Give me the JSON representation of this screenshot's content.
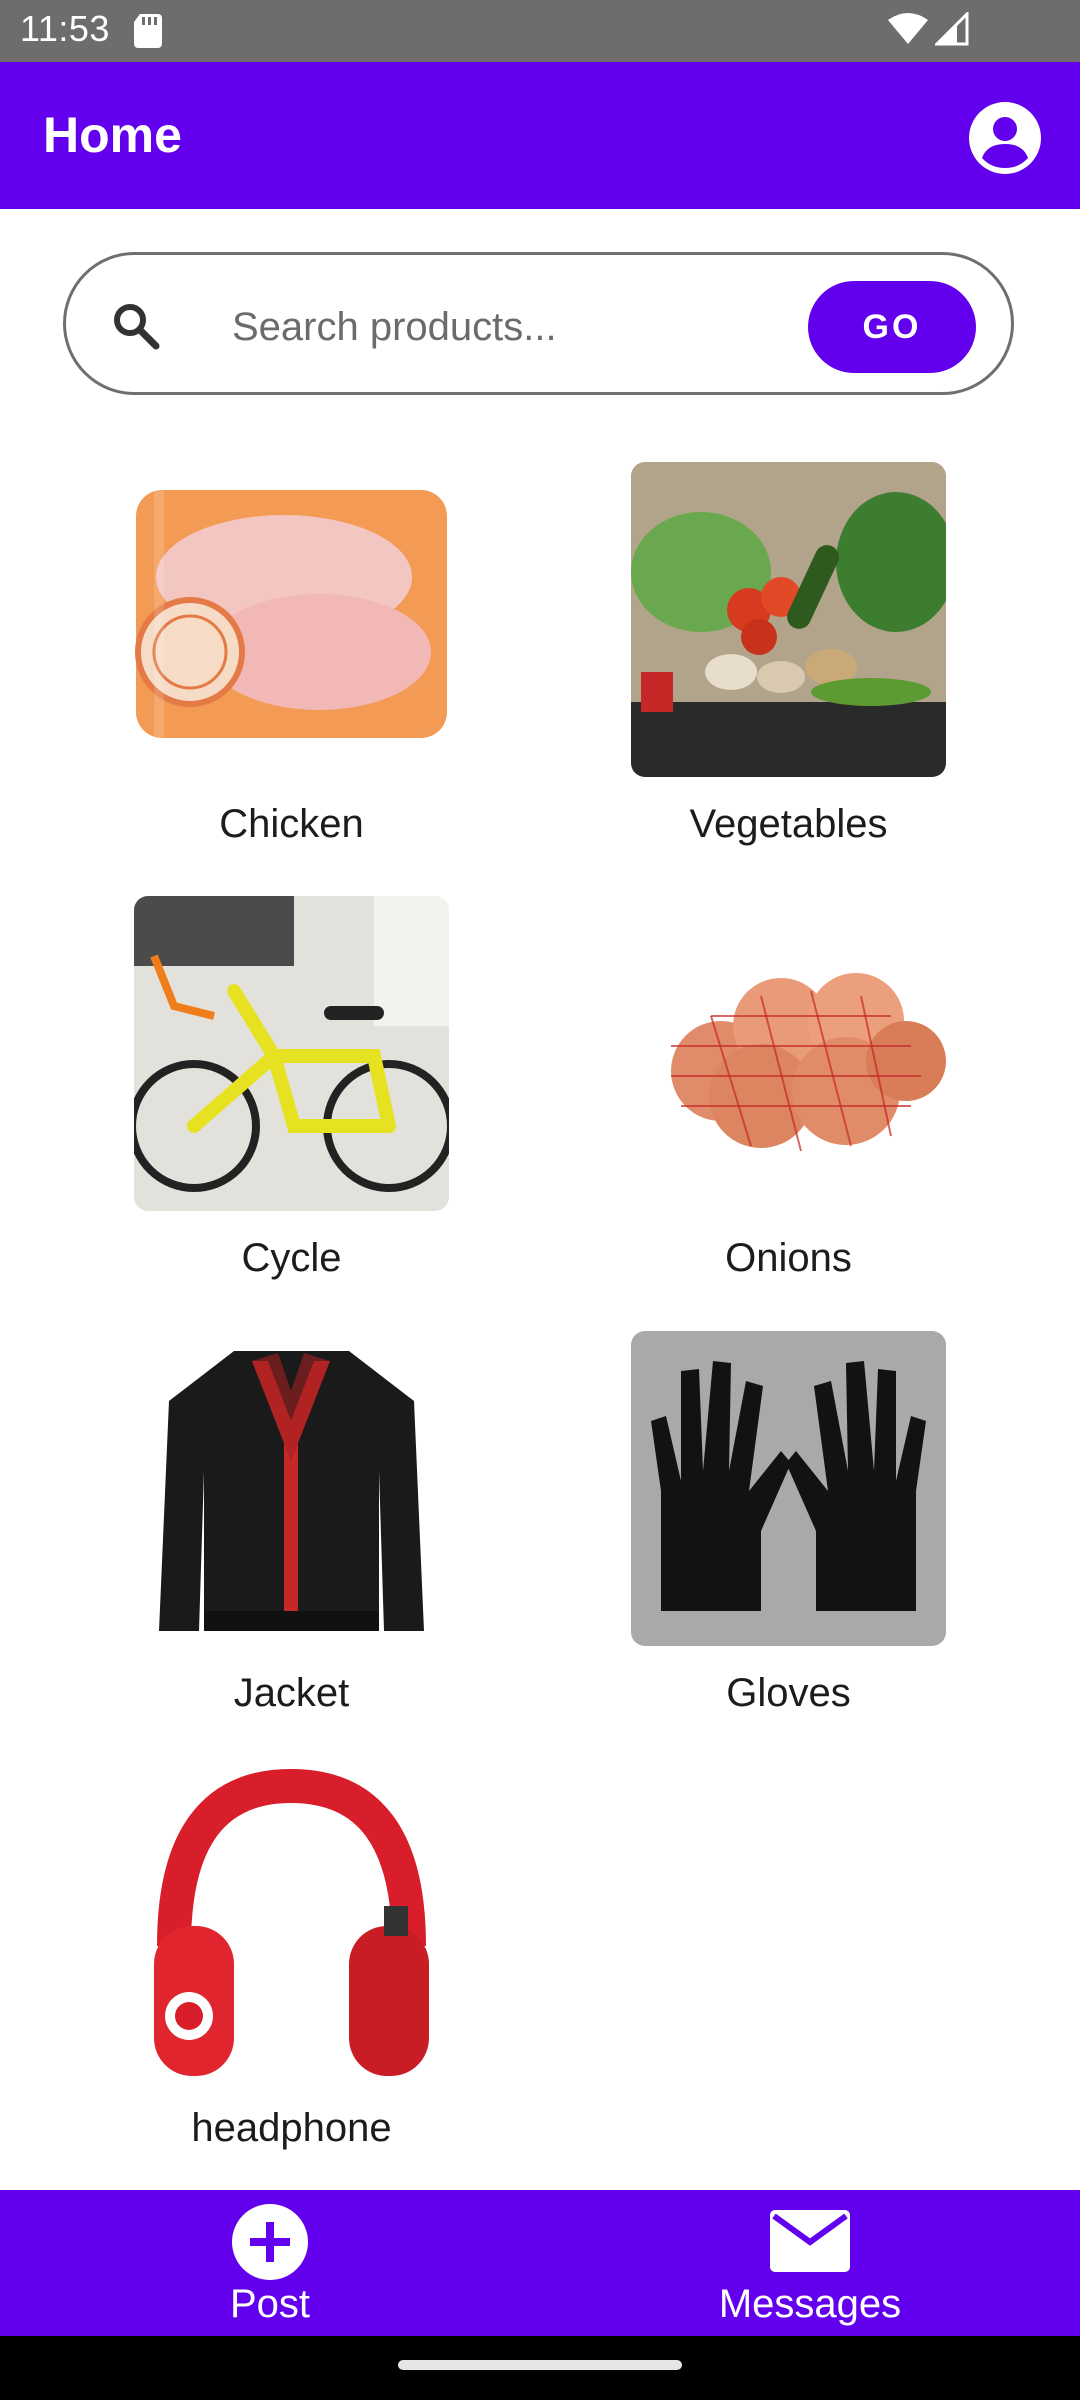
{
  "status_bar": {
    "time": "11:53"
  },
  "app_bar": {
    "title": "Home"
  },
  "search": {
    "placeholder": "Search products...",
    "go_label": "GO"
  },
  "products": [
    {
      "label": "Chicken"
    },
    {
      "label": "Vegetables"
    },
    {
      "label": "Cycle"
    },
    {
      "label": "Onions"
    },
    {
      "label": "Jacket"
    },
    {
      "label": "Gloves"
    },
    {
      "label": "headphone"
    }
  ],
  "bottom_nav": {
    "post_label": "Post",
    "messages_label": "Messages"
  },
  "colors": {
    "primary": "#6200ee",
    "status_bar": "#6d6d6d"
  },
  "icons": {
    "profile": "account-circle-icon",
    "search": "search-icon",
    "post": "add-circle-icon",
    "messages": "mail-icon"
  }
}
